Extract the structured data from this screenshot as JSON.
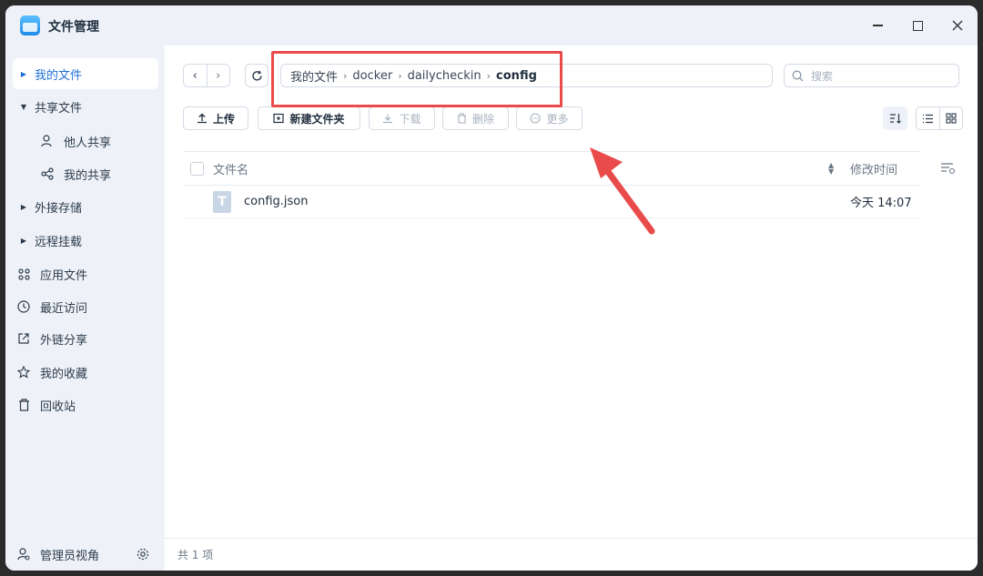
{
  "app": {
    "title": "文件管理",
    "icon": "file-manager-icon"
  },
  "window_controls": [
    "minimize-icon",
    "maximize-icon",
    "close-icon"
  ],
  "sidebar": {
    "items": [
      {
        "label": "我的文件",
        "type": "expandable",
        "active": true
      },
      {
        "label": "共享文件",
        "type": "expanded"
      },
      {
        "label": "他人共享",
        "type": "sub",
        "icon": "users-icon"
      },
      {
        "label": "我的共享",
        "type": "sub",
        "icon": "share-icon"
      },
      {
        "label": "外接存储",
        "type": "expandable"
      },
      {
        "label": "远程挂载",
        "type": "expandable"
      },
      {
        "label": "应用文件",
        "icon": "apps-grid-icon"
      },
      {
        "label": "最近访问",
        "icon": "clock-icon"
      },
      {
        "label": "外链分享",
        "icon": "external-link-icon"
      },
      {
        "label": "我的收藏",
        "icon": "star-icon"
      },
      {
        "label": "回收站",
        "icon": "trash-icon"
      }
    ],
    "footer": {
      "label": "管理员视角",
      "icon": "admin-user-icon",
      "settings_icon": "gear-icon"
    }
  },
  "path": {
    "segments": [
      "我的文件",
      "docker",
      "dailycheckin",
      "config"
    ]
  },
  "search": {
    "placeholder": "搜索"
  },
  "toolbar": {
    "upload": "上传",
    "new_folder": "新建文件夹",
    "download": "下载",
    "delete": "删除",
    "more": "更多"
  },
  "table": {
    "headers": {
      "name": "文件名",
      "modified": "修改时间"
    },
    "rows": [
      {
        "name": "config.json",
        "modified": "今天 14:07",
        "icon": "text-file-icon",
        "icon_letter": "T"
      }
    ]
  },
  "status": {
    "count_text": "共 1 项"
  },
  "colors": {
    "accent": "#1f6fd8",
    "sidebar_bg": "#eef2f8",
    "annotation": "#e94b4b"
  }
}
